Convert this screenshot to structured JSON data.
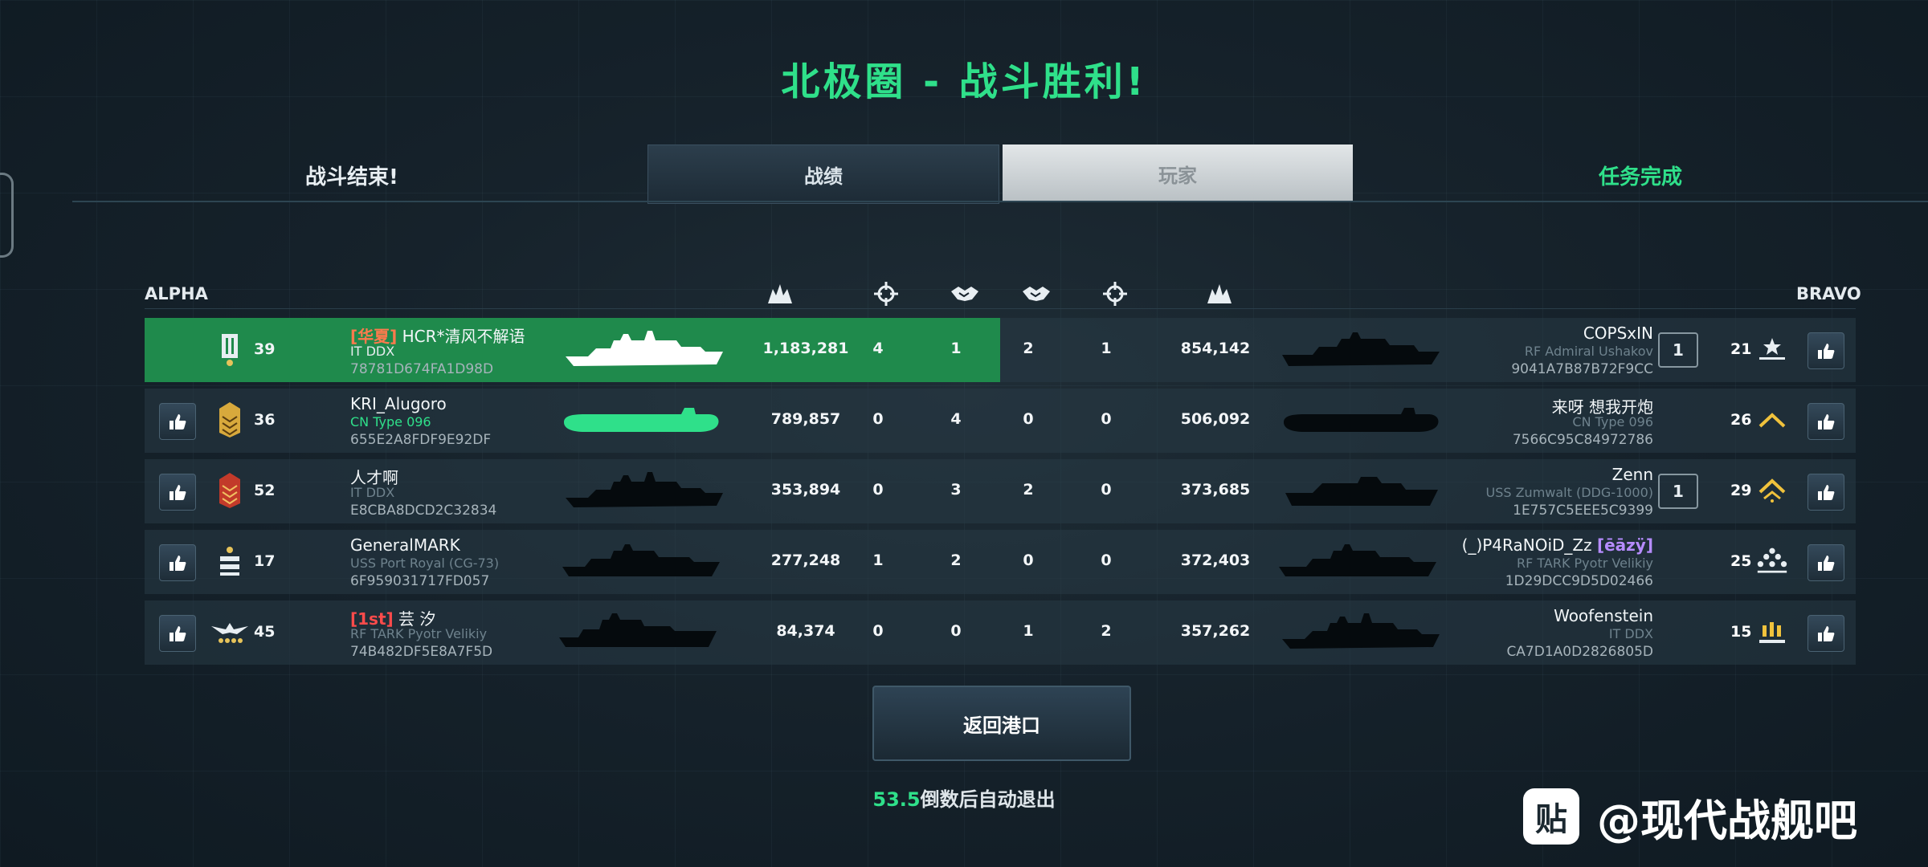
{
  "title": "北极圈 - 战斗胜利!",
  "header": {
    "status_left": "战斗结束!",
    "tabs": [
      {
        "label": "战绩"
      },
      {
        "label": "玩家"
      }
    ],
    "status_right": "任务完成"
  },
  "teams": {
    "alpha": "ALPHA",
    "bravo": "BRAVO"
  },
  "columns": [
    "damage-icon",
    "target-icon",
    "handshake-icon",
    "handshake-icon",
    "target-icon",
    "damage-icon"
  ],
  "alpha_rows": [
    {
      "tag": "[华夏]",
      "name": "HCR*清风不解语",
      "ship": "IT DDX",
      "id": "78781D674FA1D98D",
      "level": "39",
      "damage": "1,183,281",
      "kills": "4",
      "assists": "1",
      "highlight": true,
      "ship_color": "#ffffff"
    },
    {
      "tag": "",
      "name": "KRI_Alugoro",
      "ship": "CN Type 096",
      "id": "655E2A8FDF9E92DF",
      "level": "36",
      "damage": "789,857",
      "kills": "0",
      "assists": "4",
      "highlight": false,
      "ship_color": "#2fe08a"
    },
    {
      "tag": "",
      "name": "人才啊",
      "ship": "IT DDX",
      "id": "E8CBA8DCD2C32834",
      "level": "52",
      "damage": "353,894",
      "kills": "0",
      "assists": "3",
      "highlight": false,
      "ship_color": "#050a0d"
    },
    {
      "tag": "",
      "name": "GeneralMARK",
      "ship": "USS Port Royal (CG-73)",
      "id": "6F959031717FD057",
      "level": "17",
      "damage": "277,248",
      "kills": "1",
      "assists": "2",
      "highlight": false,
      "ship_color": "#050a0d"
    },
    {
      "tag": "[1st]",
      "name": "芸 汐",
      "ship": "RF TARK Pyotr Velikiy",
      "id": "74B482DF5E8A7F5D",
      "level": "45",
      "damage": "84,374",
      "kills": "0",
      "assists": "0",
      "highlight": false,
      "ship_color": "#050a0d"
    }
  ],
  "bravo_rows": [
    {
      "name": "COPSxIN",
      "tag": "",
      "ship": "RF Admiral Ushakov",
      "id": "9041A7B87B72F9CC",
      "level": "21",
      "damage": "854,142",
      "kills": "1",
      "assists": "2",
      "badge": "1"
    },
    {
      "name": "来呀 想我开炮",
      "tag": "",
      "ship": "CN Type 096",
      "id": "7566C95C84972786",
      "level": "26",
      "damage": "506,092",
      "kills": "0",
      "assists": "0",
      "badge": ""
    },
    {
      "name": "Zenn",
      "tag": "",
      "ship": "USS Zumwalt (DDG-1000)",
      "id": "1E757C5EEE5C9399",
      "level": "29",
      "damage": "373,685",
      "kills": "0",
      "assists": "2",
      "badge": "1"
    },
    {
      "name": "(_)P4RaNOiD_Zz",
      "tag": "[ēāzÿ]",
      "ship": "RF TARK Pyotr Velikiy",
      "id": "1D29DCC9D5D02466",
      "level": "25",
      "damage": "372,403",
      "kills": "0",
      "assists": "0",
      "badge": ""
    },
    {
      "name": "Woofenstein",
      "tag": "",
      "ship": "IT DDX",
      "id": "CA7D1A0D2826805D",
      "level": "15",
      "damage": "357,262",
      "kills": "2",
      "assists": "1",
      "badge": ""
    }
  ],
  "return_button": "返回港口",
  "countdown": {
    "value": "53.5",
    "text": "倒数后自动退出"
  },
  "watermark": {
    "logo": "贴",
    "text": "@现代战舰吧"
  },
  "colors": {
    "accent": "#2fe08a",
    "highlight_row": "#1f8a4c",
    "background": "#16222b"
  }
}
